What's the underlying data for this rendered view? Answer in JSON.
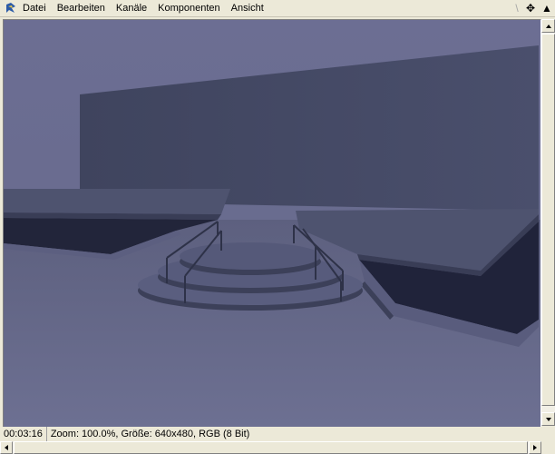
{
  "menu": {
    "app_icon": "app-logo-icon",
    "items": [
      {
        "label": "Datei"
      },
      {
        "label": "Bearbeiten"
      },
      {
        "label": "Kanäle"
      },
      {
        "label": "Komponenten"
      },
      {
        "label": "Ansicht"
      }
    ],
    "tools": {
      "dim_glyph": "\\",
      "move_glyph": "✥",
      "up_glyph": "▲"
    }
  },
  "render": {
    "description_icon": "render-preview-image",
    "colors": {
      "background": "#6a6c90",
      "wall": "#444a66",
      "platform_top": "#50546f",
      "platform_edge": "#3a3e57",
      "pit": "#23263a",
      "floor": "#676a8c"
    }
  },
  "status": {
    "time": "00:03:16",
    "info": "Zoom: 100.0%, Größe: 640x480, RGB (8 Bit)"
  }
}
